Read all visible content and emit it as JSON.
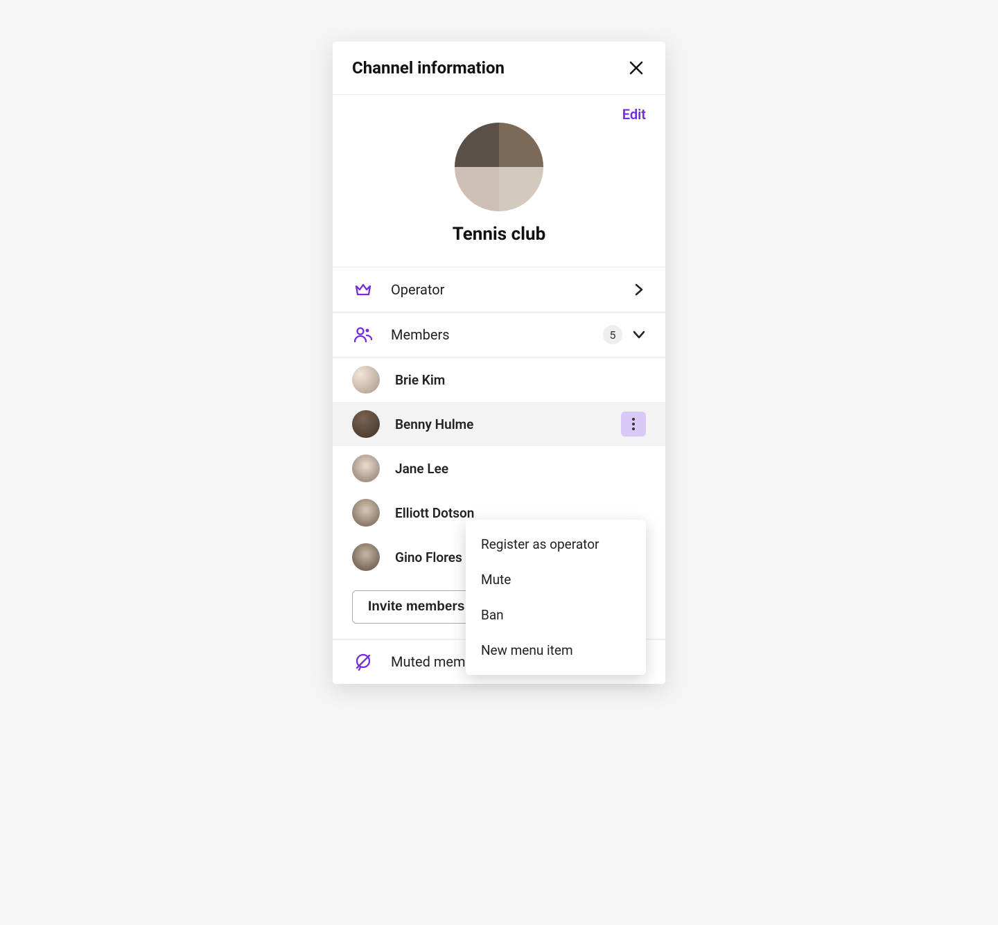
{
  "header": {
    "title": "Channel information",
    "edit": "Edit"
  },
  "channel": {
    "name": "Tennis club"
  },
  "sections": {
    "operator": {
      "label": "Operator"
    },
    "members": {
      "label": "Members",
      "count": "5"
    },
    "muted": {
      "label": "Muted members"
    }
  },
  "members": [
    {
      "name": "Brie Kim"
    },
    {
      "name": "Benny Hulme",
      "active": true
    },
    {
      "name": "Jane Lee"
    },
    {
      "name": "Elliott Dotson"
    },
    {
      "name": "Gino Flores"
    }
  ],
  "invite": {
    "label": "Invite members"
  },
  "dropdown": {
    "items": [
      "Register as operator",
      "Mute",
      "Ban",
      "New menu item"
    ]
  },
  "colors": {
    "accent": "#742ddd"
  }
}
